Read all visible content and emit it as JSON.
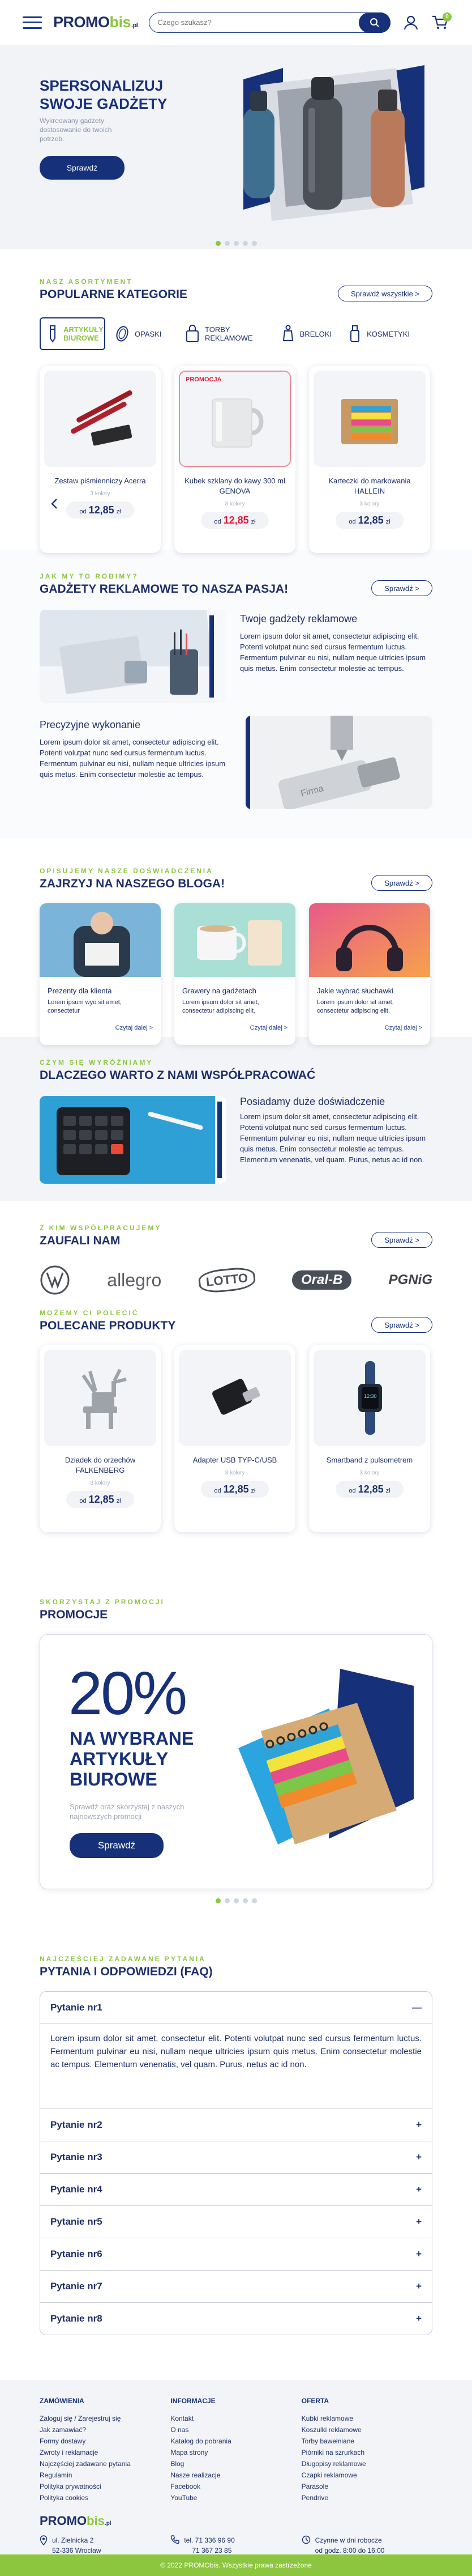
{
  "header": {
    "logo_main": "PROMO",
    "logo_bis": "bis",
    "logo_pl": ".pl",
    "search_placeholder": "Czego szukasz?",
    "cart_count": "0"
  },
  "hero": {
    "title": "SPERSONALIZUJ SWOJE GADŻETY",
    "subtitle": "Wykreowany gadżety dostosowanie do twoich potrzeb.",
    "button": "Sprawdź",
    "slides": 5,
    "active_slide": 0
  },
  "categories": {
    "kicker": "NASZ ASORTYMENT",
    "title": "POPULARNE KATEGORIE",
    "button": "Sprawdź wszystkie >",
    "tabs": [
      {
        "label": "ARTYKUŁY BIUROWE",
        "icon": "pen-icon"
      },
      {
        "label": "OPASKI",
        "icon": "wristband-icon"
      },
      {
        "label": "TORBY REKLAMOWE",
        "icon": "bag-icon"
      },
      {
        "label": "BRELOKI",
        "icon": "keychain-icon"
      },
      {
        "label": "KOSMETYKI",
        "icon": "cosmetic-icon"
      }
    ],
    "products": [
      {
        "name": "Zestaw piśmienniczy Acerra",
        "colors": "3 kolory",
        "price_prefix": "od",
        "price": "12,85",
        "currency": "zł",
        "promo": ""
      },
      {
        "name": "Kubek szklany do kawy 300 ml GENOVA",
        "colors": "3 kolory",
        "price_prefix": "od",
        "price": "12,85",
        "currency": "zł",
        "promo": "PROMOCJA"
      },
      {
        "name": "Karteczki do markowania HALLEIN",
        "colors": "3 kolory",
        "price_prefix": "od",
        "price": "12,85",
        "currency": "zł",
        "promo": ""
      }
    ]
  },
  "passion": {
    "kicker": "JAK MY TO ROBIMY?",
    "title": "GADŻETY REKLAMOWE TO NASZA PASJA!",
    "button": "Sprawdź >",
    "block1_title": "Twoje gadżety reklamowe",
    "block1_text": "Lorem ipsum dolor sit amet, consectetur adipiscing elit. Potenti volutpat nunc sed cursus fermentum luctus. Fermentum pulvinar eu nisi, nullam neque ultricies ipsum quis metus. Enim consectetur molestie ac tempus.",
    "block2_title": "Precyzyjne wykonanie",
    "block2_text": "Lorem ipsum dolor sit amet, consectetur adipiscing elit. Potenti volutpat nunc sed cursus fermentum luctus. Fermentum pulvinar eu nisi, nullam neque ultricies ipsum quis metus. Enim consectetur molestie ac tempus."
  },
  "blog": {
    "kicker": "OPISUJEMY NASZE DOŚWIADCZENIA",
    "title": "ZAJRZYJ NA NASZEGO BLOGA!",
    "button": "Sprawdź >",
    "posts": [
      {
        "title": "Prezenty dla klienta",
        "text": "Lorem ipsum wyo sit amet, consectetur",
        "more": "Czytaj dalej >"
      },
      {
        "title": "Grawery na gadżetach",
        "text": "Lorem ipsum dolor sit amet, consectetur adipiscing elit.",
        "more": "Czytaj dalej >"
      },
      {
        "title": "Jakie wybrać słuchawki",
        "text": "Lorem ipsum dolor sit amet, consectetur adipiscing elit.",
        "more": "Czytaj dalej >"
      }
    ]
  },
  "why": {
    "kicker": "CZYM SIĘ WYRÓŻNIAMY",
    "title": "DLACZEGO WARTO Z NAMI WSPÓŁPRACOWAĆ",
    "block_title": "Posiadamy duże doświadczenie",
    "block_text": "Lorem ipsum dolor sit amet, consectetur adipiscing elit. Potenti volutpat nunc sed cursus fermentum luctus. Fermentum pulvinar eu nisi, nullam neque ultricies ipsum quis metus. Enim consectetur molestie ac tempus. Elementum venenatis, vel quam. Purus, netus ac id non."
  },
  "partners": {
    "kicker": "Z KIM WSPÓŁPRACUJEMY",
    "title": "ZAUFALI NAM",
    "button": "Sprawdź >",
    "logos": [
      "VW",
      "allegro",
      "LOTTO",
      "Oral-B",
      "PGNiG"
    ]
  },
  "recommended": {
    "kicker": "MOŻEMY CI POLECIĆ",
    "title": "POLECANE PRODUKTY",
    "button": "Sprawdź >",
    "products": [
      {
        "name": "Dziadek do orzechów FALKENBERG",
        "colors": "3 kolory",
        "price_prefix": "od",
        "price": "12,85",
        "currency": "zł"
      },
      {
        "name": "Adapter USB TYP-C/USB",
        "colors": "3 kolory",
        "price_prefix": "od",
        "price": "12,85",
        "currency": "zł"
      },
      {
        "name": "Smartband z pulsometrem",
        "colors": "3 kolory",
        "price_prefix": "od",
        "price": "12,85",
        "currency": "zł"
      }
    ]
  },
  "promo": {
    "kicker": "SKORZYSTAJ Z PROMOCJI",
    "title": "PROMOCJE",
    "percent": "20%",
    "headline": "NA WYBRANE ARTYKUŁY BIUROWE",
    "subtitle": "Sprawdź oraz skorzystaj z naszych najnowszych promocji",
    "button": "Sprawdź",
    "slides": 5,
    "active_slide": 0
  },
  "faq": {
    "kicker": "NAJCZĘŚCIEJ ZADAWANE PYTANIA",
    "title": "PYTANIA I ODPOWIEDZI (FAQ)",
    "items": [
      {
        "q": "Pytanie nr1",
        "a": "Lorem ipsum dolor sit amet, consectetur elit. Potenti volutpat nunc sed cursus fermentum luctus. Fermentum pulvinar eu nisi, nullam neque ultricies ipsum quis metus. Enim consectetur molestie ac tempus. Elementum venenatis, vel quam. Purus, netus ac id non.",
        "open": true
      },
      {
        "q": "Pytanie nr2",
        "a": "",
        "open": false
      },
      {
        "q": "Pytanie nr3",
        "a": "",
        "open": false
      },
      {
        "q": "Pytanie nr4",
        "a": "",
        "open": false
      },
      {
        "q": "Pytanie nr5",
        "a": "",
        "open": false
      },
      {
        "q": "Pytanie nr6",
        "a": "",
        "open": false
      },
      {
        "q": "Pytanie nr7",
        "a": "",
        "open": false
      },
      {
        "q": "Pytanie nr8",
        "a": "",
        "open": false
      }
    ]
  },
  "footer": {
    "col1_title": "ZAMÓWIENIA",
    "col1_links": [
      "Zaloguj się / Zarejestruj się",
      "Jak zamawiać?",
      "Formy dostawy",
      "Zwroty i reklamacje",
      "Najczęściej zadawane pytania",
      "Regulamin",
      "Polityka prywatności",
      "Polityka cookies"
    ],
    "col2_title": "INFORMACJE",
    "col2_links": [
      "Kontakt",
      "O nas",
      "Katalog do pobrania",
      "Mapa strony",
      "Blog",
      "Nasze realizacje",
      "Facebook",
      "YouTube"
    ],
    "col3_title": "OFERTA",
    "col3_links": [
      "Kubki reklamowe",
      "Koszulki reklamowe",
      "Torby bawełniane",
      "Piórniki na szrurkach",
      "Długopisy reklamowe",
      "Czapki reklamowe",
      "Parasole",
      "Pendrive"
    ],
    "address_line1": "ul. Zielnicka 2",
    "address_line2": "52-336 Wrocław",
    "phone1": "tel. 71 336 96 90",
    "phone2": "71 367 23 85",
    "hours_line1": "Czynne w dni robocze",
    "hours_line2": "od godz. 8:00 do 16:00",
    "copyright": "© 2022 PROMObis. Wszystkie prawa zastrzeżone"
  }
}
